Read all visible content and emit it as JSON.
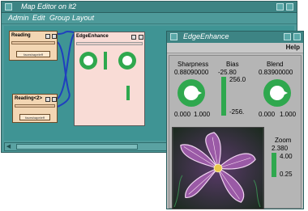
{
  "main_window": {
    "title": "Map Editor on lt2",
    "menu": [
      "Admin",
      "Edit",
      "Group",
      "Layout"
    ],
    "modules": {
      "reading_top": {
        "title": "Reading",
        "label": "faceshapeleff"
      },
      "reading_bottom": {
        "title": "Reading<2>",
        "label": "faceshapeleff"
      },
      "edge": {
        "title": "EdgeEnhance"
      }
    }
  },
  "edge_window": {
    "title": "EdgeEnhance",
    "help_label": "Help",
    "sharpness": {
      "label": "Sharpness",
      "value": "0.88090000",
      "min": "0.000",
      "max": "1.000",
      "level": 0.88
    },
    "bias": {
      "label": "Bias",
      "value": "-25.80",
      "top": "256.0",
      "bottom": "-256.",
      "level": 0.45
    },
    "blend": {
      "label": "Blend",
      "value": "0.83900000",
      "min": "0.000",
      "max": "1.000",
      "level": 0.84
    },
    "zoom": {
      "label": "Zoom",
      "value": "2.380",
      "max": "4.00",
      "min": "0.25",
      "level": 0.57
    }
  },
  "colors": {
    "window_teal": "#4e9a9a",
    "canvas_teal": "#3f9494",
    "dial_green": "#2fa84e",
    "module_tan": "#f3d6b3",
    "module_pink": "#f9dcd6",
    "panel_gray": "#b5b5b5"
  },
  "icons": [
    "window-menu-icon",
    "minimize-icon",
    "maximize-icon",
    "connection-wire",
    "dial-pointer-icon"
  ]
}
